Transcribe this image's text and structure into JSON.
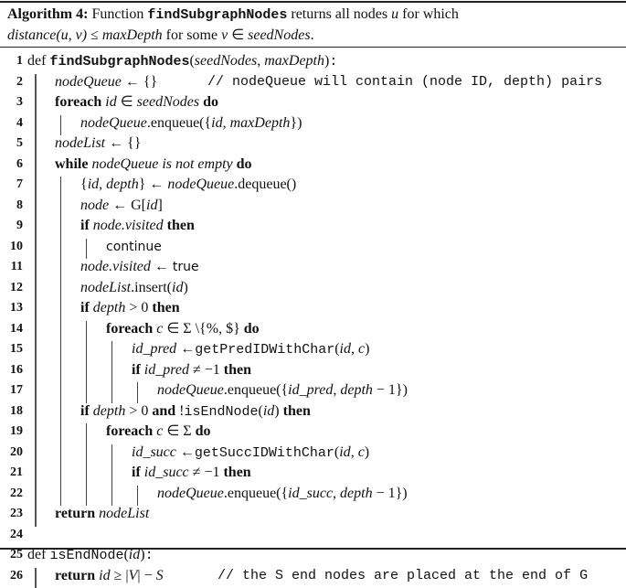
{
  "caption": {
    "label": "Algorithm 4:",
    "text_pre": " Function ",
    "func": "findSubgraphNodes",
    "text_mid": " returns all nodes ",
    "var_u": "u",
    "text_post": " for which",
    "line2_dist": "distance",
    "line2_args": "(u, v)",
    "line2_le": " ≤ ",
    "line2_maxdepth": "maxDepth",
    "line2_for": " for some ",
    "line2_v": "v",
    "line2_in": " ∈ ",
    "line2_seed": "seedNodes",
    "line2_end": "."
  },
  "lines": [
    {
      "n": "1",
      "parts": [
        [
          "def ",
          ""
        ],
        [
          "findSubgraphNodes",
          "tt"
        ],
        [
          "(",
          ""
        ],
        [
          "seedNodes",
          "i"
        ],
        [
          ", ",
          ""
        ],
        [
          "maxDepth",
          "i"
        ],
        [
          ")",
          ""
        ],
        [
          ":",
          "ttn"
        ]
      ]
    },
    {
      "n": "2",
      "parts": [
        [
          "nodeQueue",
          "i"
        ],
        [
          " ← {}",
          ""
        ]
      ],
      "comment": "// nodeQueue will contain (node ID, depth) pairs"
    },
    {
      "n": "3",
      "parts": [
        [
          "foreach ",
          "b"
        ],
        [
          "id",
          "i"
        ],
        [
          " ∈ ",
          ""
        ],
        [
          "seedNodes",
          "i"
        ],
        [
          " do",
          "b"
        ]
      ]
    },
    {
      "n": "4",
      "parts": [
        [
          "nodeQueue",
          "i"
        ],
        [
          ".enqueue({",
          ""
        ],
        [
          "id",
          "i"
        ],
        [
          ", ",
          ""
        ],
        [
          "maxDepth",
          "i"
        ],
        [
          "})",
          ""
        ]
      ]
    },
    {
      "n": "5",
      "parts": [
        [
          "nodeList",
          "i"
        ],
        [
          " ← {}",
          ""
        ]
      ]
    },
    {
      "n": "6",
      "parts": [
        [
          "while ",
          "b"
        ],
        [
          "nodeQueue is not empty",
          "i"
        ],
        [
          " do",
          "b"
        ]
      ]
    },
    {
      "n": "7",
      "parts": [
        [
          "{",
          ""
        ],
        [
          "id",
          "i"
        ],
        [
          ", ",
          ""
        ],
        [
          "depth",
          "i"
        ],
        [
          "} ← ",
          ""
        ],
        [
          "nodeQueue",
          "i"
        ],
        [
          ".dequeue()",
          ""
        ]
      ]
    },
    {
      "n": "8",
      "parts": [
        [
          "node",
          "i"
        ],
        [
          " ← G[",
          ""
        ],
        [
          "id",
          "i"
        ],
        [
          "]",
          ""
        ]
      ]
    },
    {
      "n": "9",
      "parts": [
        [
          "if ",
          "b"
        ],
        [
          "node.visited",
          "i"
        ],
        [
          " then",
          "b"
        ]
      ]
    },
    {
      "n": "10",
      "parts": [
        [
          "continue",
          "sf"
        ]
      ]
    },
    {
      "n": "11",
      "parts": [
        [
          "node.visited",
          "i"
        ],
        [
          " ← ",
          ""
        ],
        [
          "true",
          "sf"
        ]
      ]
    },
    {
      "n": "12",
      "parts": [
        [
          "nodeList",
          "i"
        ],
        [
          ".insert(",
          ""
        ],
        [
          "id",
          "i"
        ],
        [
          ")",
          ""
        ]
      ]
    },
    {
      "n": "13",
      "parts": [
        [
          "if ",
          "b"
        ],
        [
          "depth",
          "i"
        ],
        [
          " > 0",
          ""
        ],
        [
          " then",
          "b"
        ]
      ]
    },
    {
      "n": "14",
      "parts": [
        [
          "foreach ",
          "b"
        ],
        [
          "c",
          "i"
        ],
        [
          " ∈ Σ \\{%, $}",
          ""
        ],
        [
          " do",
          "b"
        ]
      ]
    },
    {
      "n": "15",
      "parts": [
        [
          "id_pred",
          "i"
        ],
        [
          " ←",
          ""
        ],
        [
          "getPredIDWithChar",
          "ttn"
        ],
        [
          "(",
          ""
        ],
        [
          "id",
          "i"
        ],
        [
          ", ",
          ""
        ],
        [
          "c",
          "i"
        ],
        [
          ")",
          ""
        ]
      ]
    },
    {
      "n": "16",
      "parts": [
        [
          "if ",
          "b"
        ],
        [
          "id_pred",
          "i"
        ],
        [
          " ≠ −1",
          ""
        ],
        [
          " then",
          "b"
        ]
      ]
    },
    {
      "n": "17",
      "parts": [
        [
          "nodeQueue",
          "i"
        ],
        [
          ".enqueue({",
          ""
        ],
        [
          "id_pred",
          "i"
        ],
        [
          ", ",
          ""
        ],
        [
          "depth",
          "i"
        ],
        [
          " − 1})",
          ""
        ]
      ]
    },
    {
      "n": "18",
      "parts": [
        [
          "if ",
          "b"
        ],
        [
          "depth",
          "i"
        ],
        [
          " > 0 ",
          ""
        ],
        [
          "and",
          "b"
        ],
        [
          " !",
          ""
        ],
        [
          "isEndNode",
          "ttn"
        ],
        [
          "(",
          ""
        ],
        [
          "id",
          "i"
        ],
        [
          ") ",
          ""
        ],
        [
          "then",
          "b"
        ]
      ]
    },
    {
      "n": "19",
      "parts": [
        [
          "foreach ",
          "b"
        ],
        [
          "c",
          "i"
        ],
        [
          " ∈ Σ ",
          ""
        ],
        [
          "do",
          "b"
        ]
      ]
    },
    {
      "n": "20",
      "parts": [
        [
          "id_succ",
          "i"
        ],
        [
          " ←",
          ""
        ],
        [
          "getSuccIDWithChar",
          "ttn"
        ],
        [
          "(",
          ""
        ],
        [
          "id",
          "i"
        ],
        [
          ", ",
          ""
        ],
        [
          "c",
          "i"
        ],
        [
          ")",
          ""
        ]
      ]
    },
    {
      "n": "21",
      "parts": [
        [
          "if ",
          "b"
        ],
        [
          "id_succ",
          "i"
        ],
        [
          " ≠ −1",
          ""
        ],
        [
          " then",
          "b"
        ]
      ]
    },
    {
      "n": "22",
      "parts": [
        [
          "nodeQueue",
          "i"
        ],
        [
          ".enqueue({",
          ""
        ],
        [
          "id_succ",
          "i"
        ],
        [
          ", ",
          ""
        ],
        [
          "depth",
          "i"
        ],
        [
          " − 1})",
          ""
        ]
      ]
    },
    {
      "n": "23",
      "parts": [
        [
          "return ",
          "b"
        ],
        [
          "nodeList",
          "i"
        ]
      ]
    },
    {
      "n": "24",
      "parts": []
    },
    {
      "n": "25",
      "parts": [
        [
          "def ",
          ""
        ],
        [
          "isEndNode",
          "ttn"
        ],
        [
          "(",
          ""
        ],
        [
          "id",
          "i"
        ],
        [
          ")",
          ""
        ],
        [
          ":",
          "ttn"
        ]
      ]
    },
    {
      "n": "26",
      "parts": [
        [
          "return ",
          "b"
        ],
        [
          "id",
          "i"
        ],
        [
          " ≥ |",
          ""
        ],
        [
          "V",
          "i"
        ],
        [
          "| − ",
          ""
        ],
        [
          "S",
          "i"
        ]
      ],
      "comment": "// the S end nodes are placed at the end of G"
    }
  ]
}
